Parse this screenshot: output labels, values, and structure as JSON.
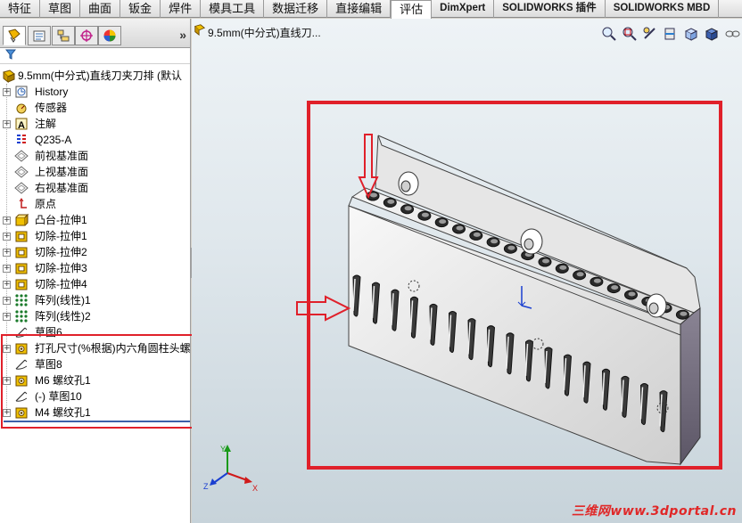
{
  "command_tabs": [
    {
      "label": "特征",
      "active": false
    },
    {
      "label": "草图",
      "active": false
    },
    {
      "label": "曲面",
      "active": false
    },
    {
      "label": "钣金",
      "active": false
    },
    {
      "label": "焊件",
      "active": false
    },
    {
      "label": "模具工具",
      "active": false
    },
    {
      "label": "数据迁移",
      "active": false
    },
    {
      "label": "直接编辑",
      "active": false
    },
    {
      "label": "评估",
      "active": true
    },
    {
      "label": "DimXpert",
      "active": false
    },
    {
      "label": "SOLIDWORKS 插件",
      "active": false
    },
    {
      "label": "SOLIDWORKS MBD",
      "active": false
    }
  ],
  "panel_tabs": [
    "feature-manager-icon",
    "property-manager-icon",
    "configuration-manager-icon",
    "dimxpert-manager-icon",
    "display-manager-icon"
  ],
  "panel_expand": "»",
  "tree": {
    "root": "9.5mm(中分式)直线刀夹刀排  (默认",
    "items": [
      {
        "label": "History",
        "icon": "history-icon",
        "expandable": true
      },
      {
        "label": "传感器",
        "icon": "sensor-icon",
        "expandable": false
      },
      {
        "label": "注解",
        "icon": "annotation-icon",
        "expandable": true
      },
      {
        "label": "Q235-A",
        "icon": "material-icon",
        "expandable": false
      },
      {
        "label": "前视基准面",
        "icon": "plane-icon",
        "expandable": false
      },
      {
        "label": "上视基准面",
        "icon": "plane-icon",
        "expandable": false
      },
      {
        "label": "右视基准面",
        "icon": "plane-icon",
        "expandable": false
      },
      {
        "label": "原点",
        "icon": "origin-icon",
        "expandable": false
      },
      {
        "label": "凸台-拉伸1",
        "icon": "boss-extrude-icon",
        "expandable": true
      },
      {
        "label": "切除-拉伸1",
        "icon": "cut-extrude-icon",
        "expandable": true
      },
      {
        "label": "切除-拉伸2",
        "icon": "cut-extrude-icon",
        "expandable": true
      },
      {
        "label": "切除-拉伸3",
        "icon": "cut-extrude-icon",
        "expandable": true
      },
      {
        "label": "切除-拉伸4",
        "icon": "cut-extrude-icon",
        "expandable": true
      },
      {
        "label": "阵列(线性)1",
        "icon": "linear-pattern-icon",
        "expandable": true
      },
      {
        "label": "阵列(线性)2",
        "icon": "linear-pattern-icon",
        "expandable": true
      },
      {
        "label": "草图6",
        "icon": "sketch-icon",
        "expandable": false
      },
      {
        "label": "打孔尺寸(%根据)内六角圆柱头螺",
        "icon": "hole-wizard-icon",
        "expandable": true
      },
      {
        "label": "草图8",
        "icon": "sketch-icon",
        "expandable": false
      },
      {
        "label": "M6 螺纹孔1",
        "icon": "hole-wizard-icon",
        "expandable": true
      },
      {
        "label": "(-) 草图10",
        "icon": "sketch-icon",
        "expandable": false
      },
      {
        "label": "M4 螺纹孔1",
        "icon": "hole-wizard-icon",
        "expandable": true
      }
    ]
  },
  "viewport": {
    "doc_title": "9.5mm(中分式)直线刀...",
    "heads_up_icons": [
      "zoom-to-fit-icon",
      "zoom-area-icon",
      "previous-view-icon",
      "section-view-icon",
      "view-orientation-icon",
      "display-style-icon",
      "hide-show-icon"
    ]
  },
  "axes": {
    "x": "X",
    "y": "Y",
    "z": "Z"
  },
  "watermark": "三维网www.3dportal.cn",
  "colors": {
    "highlight_box": "#e0202a",
    "part_body": "#cfcfcf",
    "part_dark": "#6e6878"
  }
}
